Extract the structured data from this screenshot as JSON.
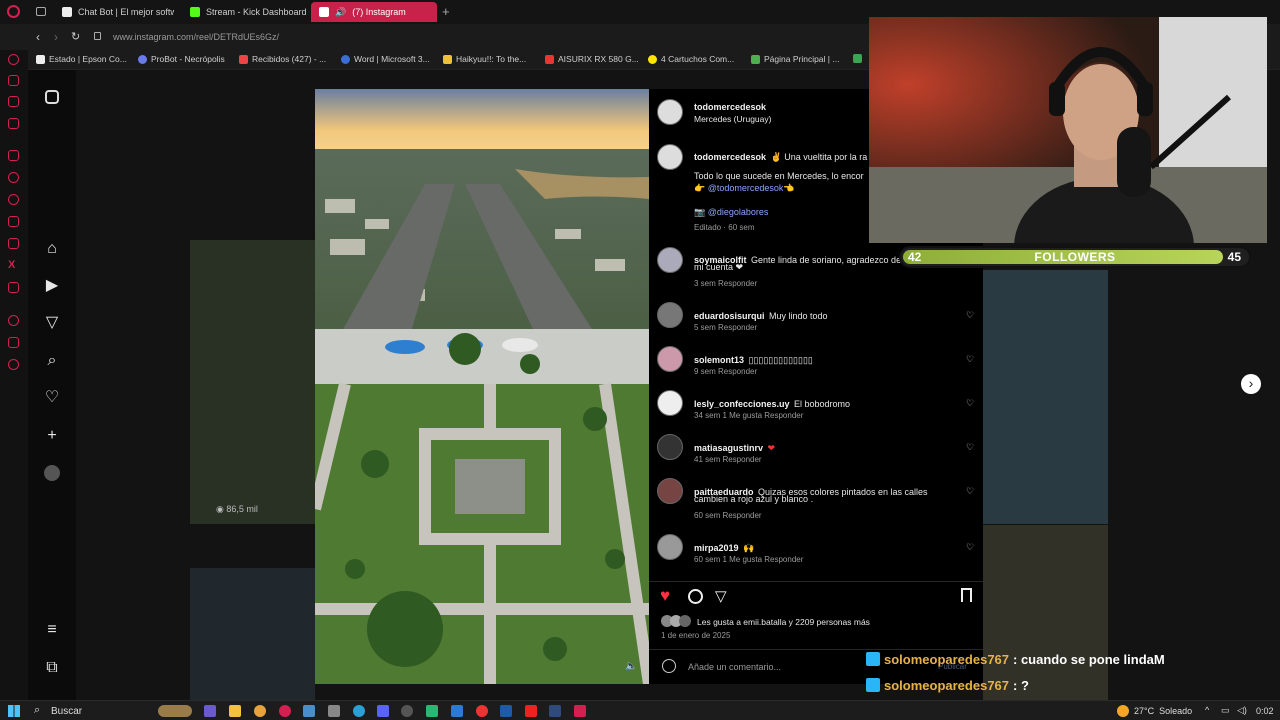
{
  "browser": {
    "tabs": [
      {
        "label": "Chat Bot | El mejor softwa",
        "color": "#2b2b2b"
      },
      {
        "label": "Stream - Kick Dashboard",
        "color": "#53fc18"
      },
      {
        "label": "(7) Instagram",
        "color": "#e1306c",
        "active": true
      }
    ],
    "url": "www.instagram.com/reel/DETRdUEs6Gz/",
    "bookmarks": [
      "Estado | Epson Co...",
      "ProBot - Necrópolis",
      "Recibidos (427) - ...",
      "Word | Microsoft 3...",
      "Haikyuu!!: To the...",
      "AISURIX RX 580 G...",
      "4 Cartuchos Com...",
      "Página Principal | ..."
    ]
  },
  "post": {
    "author": "todomercedesok",
    "location": "Mercedes (Uruguay)",
    "caption_user": "todomercedesok",
    "caption_text": "✌ Una vueltita por la ra",
    "caption_line2": "Todo lo que sucede en Mercedes, lo encor",
    "caption_mention": "👉 @todomercedesok👈",
    "caption_credit": "📷 @diegolabores",
    "edited": "Editado · 60 sem",
    "comments": [
      {
        "user": "soymaicolfit",
        "text": "Gente linda de soriano, agradezco de",
        "text2": "mi cuenta ❤",
        "meta": "3 sem   Responder"
      },
      {
        "user": "eduardosisurqui",
        "text": "Muy lindo todo",
        "meta": "5 sem   Responder"
      },
      {
        "user": "solemont13",
        "text": "▯▯▯▯▯▯▯▯▯▯▯▯▯",
        "meta": "9 sem   Responder"
      },
      {
        "user": "lesly_confecciones.uy",
        "text": "El bobodromo",
        "meta": "34 sem   1 Me gusta   Responder"
      },
      {
        "user": "matiasagustinrv",
        "text": "❤",
        "meta": "41 sem   Responder"
      },
      {
        "user": "paittaeduardo",
        "text": "Quizas esos colores pintados en las calles",
        "text2": "cambien a rojo azul y blanco .",
        "meta": "60 sem   Responder"
      },
      {
        "user": "mirpa2019",
        "text": "🙌",
        "meta": "60 sem   1 Me gusta   Responder"
      }
    ],
    "likes": "Les gusta a emii.batalla y 2209 personas más",
    "date": "1 de enero de 2025",
    "comment_placeholder": "Añade un comentario...",
    "publish": "Publicar",
    "view_count": "86,5 mil"
  },
  "overlay": {
    "followers_label": "FOLLOWERS",
    "followers_current": "42",
    "followers_goal": "45",
    "followers_progress": 0.93,
    "chat": [
      {
        "user": "solomeoparedes767",
        "msg": ": cuando se pone lindaM"
      },
      {
        "user": "solomeoparedes767",
        "msg": ": ?"
      }
    ]
  },
  "taskbar": {
    "search": "Buscar",
    "weather": "27°C  Soleado",
    "time": "0:02"
  }
}
